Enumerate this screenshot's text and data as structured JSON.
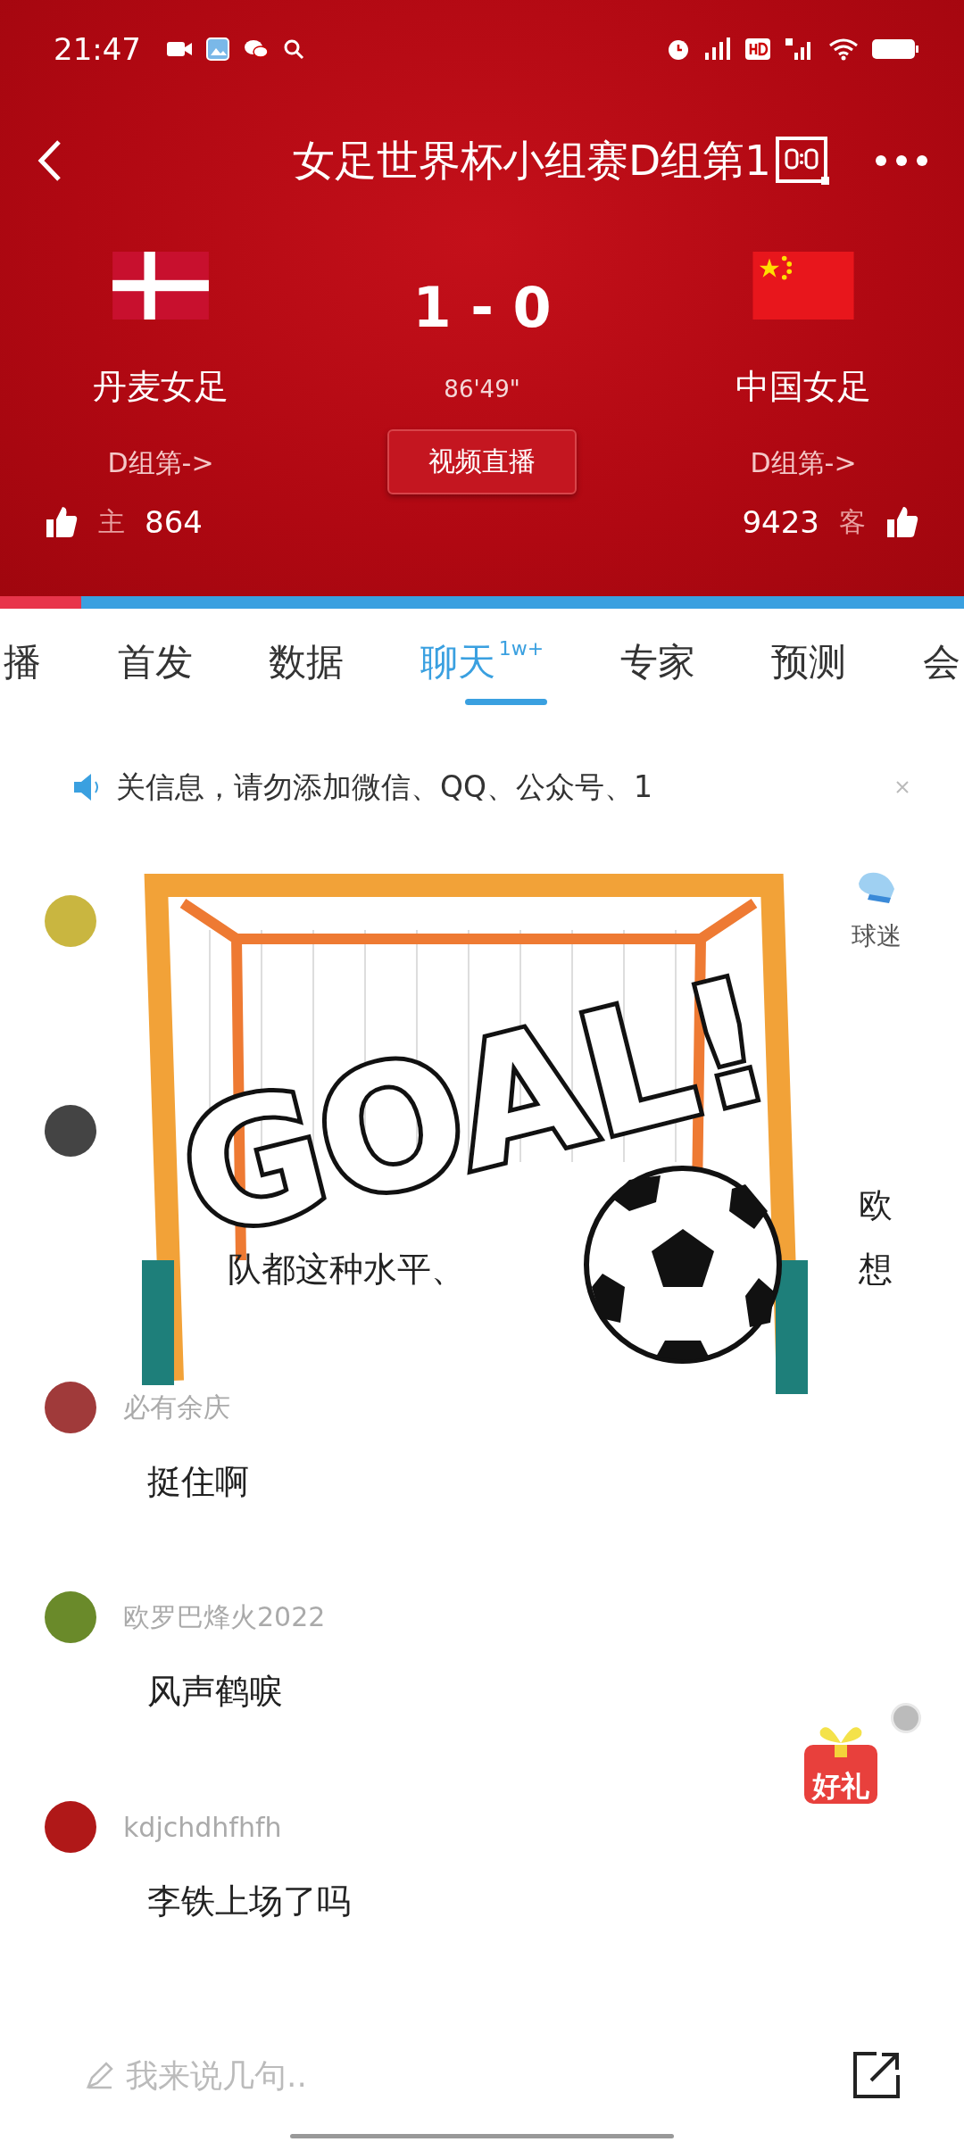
{
  "status_bar": {
    "time": "21:47"
  },
  "header": {
    "title": "女足世界杯小组赛D组第1"
  },
  "match": {
    "score": "1 - 0",
    "clock": "86'49\"",
    "live_button": "视频直播",
    "home": {
      "name": "丹麦女足",
      "group_link": "D组第->",
      "side": "主",
      "likes": "864"
    },
    "away": {
      "name": "中国女足",
      "group_link": "D组第->",
      "side": "客",
      "likes": "9423"
    }
  },
  "support_bar": {
    "level": 0.084
  },
  "tabs": [
    {
      "label": "播",
      "selected": false
    },
    {
      "label": "首发",
      "selected": false
    },
    {
      "label": "数据",
      "selected": false
    },
    {
      "label": "聊天",
      "badge": "1w+",
      "selected": true
    },
    {
      "label": "专家",
      "selected": false
    },
    {
      "label": "预测",
      "selected": false
    },
    {
      "label": "会",
      "selected": false
    }
  ],
  "notice": {
    "text": "关信息，请勿添加微信、QQ、公众号、1"
  },
  "comments": [
    {
      "badge": "球迷"
    },
    {
      "lines": [
        {
          "end": "欧"
        },
        {
          "start": "队都这种水平、",
          "end": "想"
        }
      ]
    },
    {
      "user": "必有余庆",
      "lines": [
        {
          "start": "挺住啊"
        }
      ]
    },
    {
      "user": "欧罗巴烽火2022",
      "lines": [
        {
          "start": "风声鹤唳"
        }
      ]
    },
    {
      "user": "kdjchdhfhfh",
      "lines": [
        {
          "start": "李铁上场了吗"
        }
      ]
    }
  ],
  "goal_sticker": {
    "text": "GOAL!"
  },
  "gift": {
    "label": "好礼"
  },
  "composer": {
    "placeholder": "我来说几句.."
  }
}
